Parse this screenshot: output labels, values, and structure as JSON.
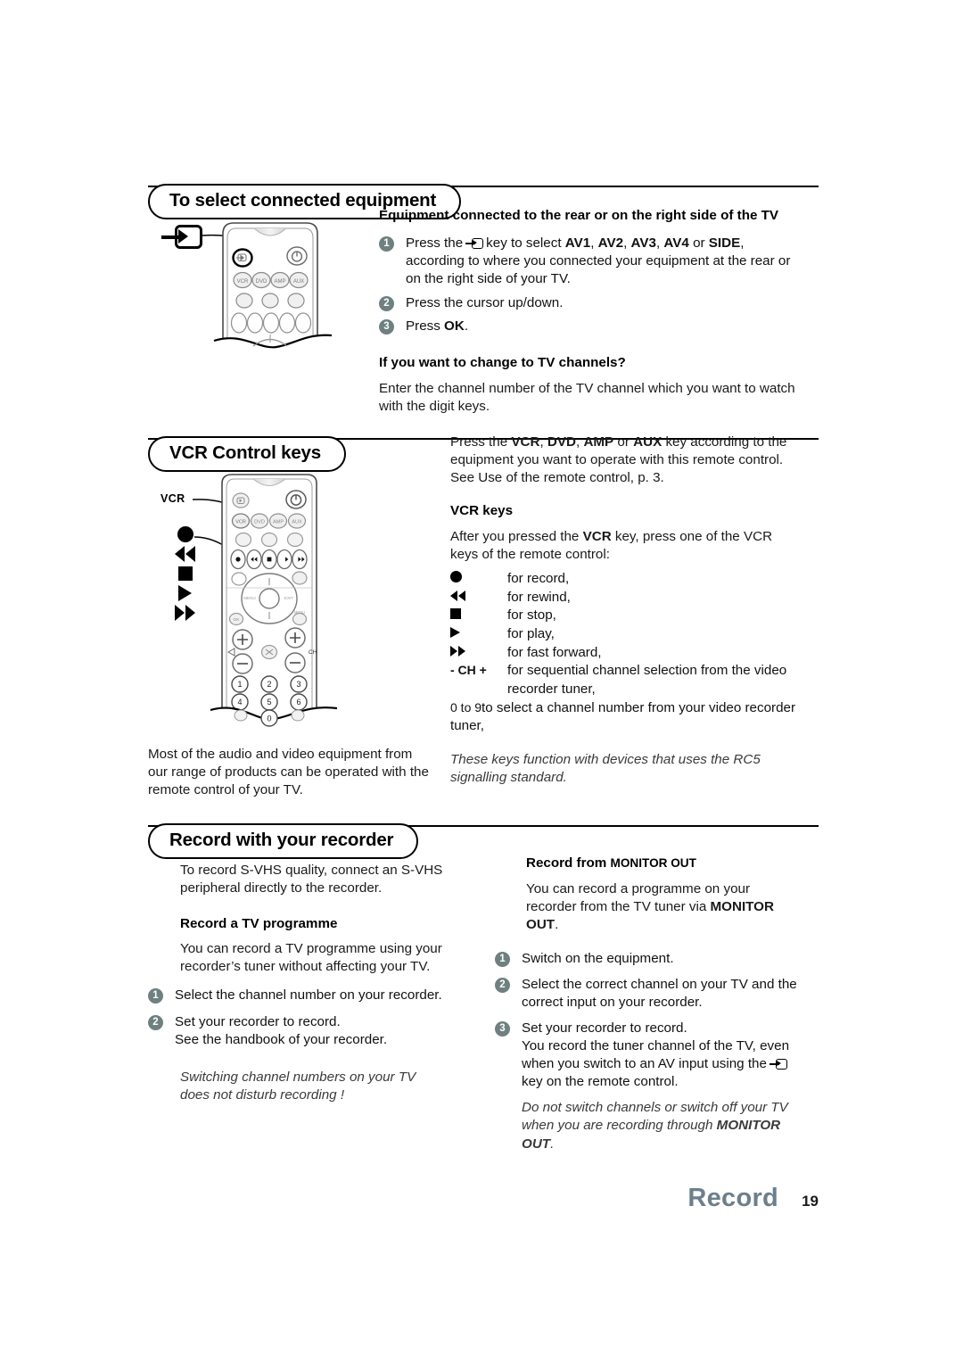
{
  "page": {
    "footer_title": "Record",
    "footer_number": "19",
    "footer_title_color": "#6d7f8c",
    "badge_color": "#6e8080"
  },
  "section1": {
    "heading": "To select connected equipment",
    "callout_icon": "av-input-icon",
    "sub_head_1": "Equipment connected to the rear or on the right side of the TV",
    "steps": [
      {
        "num": "1",
        "pre": "Press the",
        "icon": "av-input-icon",
        "post": "key to select ",
        "bold_items": [
          "AV1",
          "AV2",
          "AV3",
          "AV4",
          "SIDE"
        ],
        "tail": ", according to where you connected your equipment at the rear or on the right side of your TV."
      },
      {
        "num": "2",
        "text": "Press the cursor up/down."
      },
      {
        "num": "3",
        "text_pre": "Press ",
        "text_bold": "OK",
        "text_post": "."
      }
    ],
    "sub_head_2": "If you want to change to TV channels?",
    "para": "Enter the channel number of the TV channel which you want to watch with the digit keys."
  },
  "section2": {
    "heading": "VCR Control keys",
    "remote_label": "VCR",
    "intro_pre": "Press the ",
    "intro_bold": [
      "VCR",
      "DVD",
      "AMP",
      "AUX"
    ],
    "intro_post": " key according to the equipment you want to operate with this remote control. See Use of the remote control, p. 3.",
    "sub_head": "VCR keys",
    "lead_pre": "After you pressed the ",
    "lead_bold": "VCR",
    "lead_post": " key, press one of the VCR keys of the remote control:",
    "keys": [
      {
        "symbol": "record-icon",
        "text": "for record,"
      },
      {
        "symbol": "rewind-icon",
        "text": "for rewind,"
      },
      {
        "symbol": "stop-icon",
        "text": "for stop,"
      },
      {
        "symbol": "play-icon",
        "text": "for play,"
      },
      {
        "symbol": "fast-forward-icon",
        "text": "for fast forward,"
      },
      {
        "symbol": "- CH +",
        "text": "for sequential channel selection from the video recorder tuner,"
      },
      {
        "symbol": "0 to 9",
        "text": "to select a channel number from your video recorder tuner,"
      }
    ],
    "note": "These keys function with devices that uses the RC5 signalling standard.",
    "left_para": "Most of the audio and video equipment from our range of products can be operated with the remote control of your TV.",
    "callout_glyphs": [
      "record-icon",
      "rewind-icon",
      "stop-icon",
      "play-icon",
      "fast-forward-icon"
    ]
  },
  "section3": {
    "heading": "Record with your recorder",
    "left": {
      "intro": "To record S-VHS quality, connect an S-VHS peripheral directly to the recorder.",
      "sub_head": "Record a TV programme",
      "para": "You can record a TV programme using your recorder’s tuner without affecting your TV.",
      "steps": [
        {
          "num": "1",
          "text": "Select the channel number on your recorder."
        },
        {
          "num": "2",
          "text": "Set your recorder to record.\nSee the handbook of your recorder."
        }
      ],
      "note": "Switching channel numbers on your TV does not disturb recording !"
    },
    "right": {
      "sub_head_pre": "Record from ",
      "sub_head_caps": "MONITOR OUT",
      "para_pre": "You can record a programme on your recorder from the TV tuner via ",
      "para_bold": "MONITOR OUT",
      "para_post": ".",
      "steps": [
        {
          "num": "1",
          "text": "Switch on the equipment."
        },
        {
          "num": "2",
          "text": "Select the correct channel on your TV and the correct input on your recorder."
        },
        {
          "num": "3",
          "line1": "Set your recorder to record.",
          "line2": "You record the tuner channel of the TV, even when you switch to an AV input using the",
          "icon": "av-input-icon",
          "line3": "key on the remote control."
        }
      ],
      "note_pre": "Do not switch channels or switch off your TV when you are recording through ",
      "note_bold": "MONITOR OUT",
      "note_post": "."
    }
  }
}
